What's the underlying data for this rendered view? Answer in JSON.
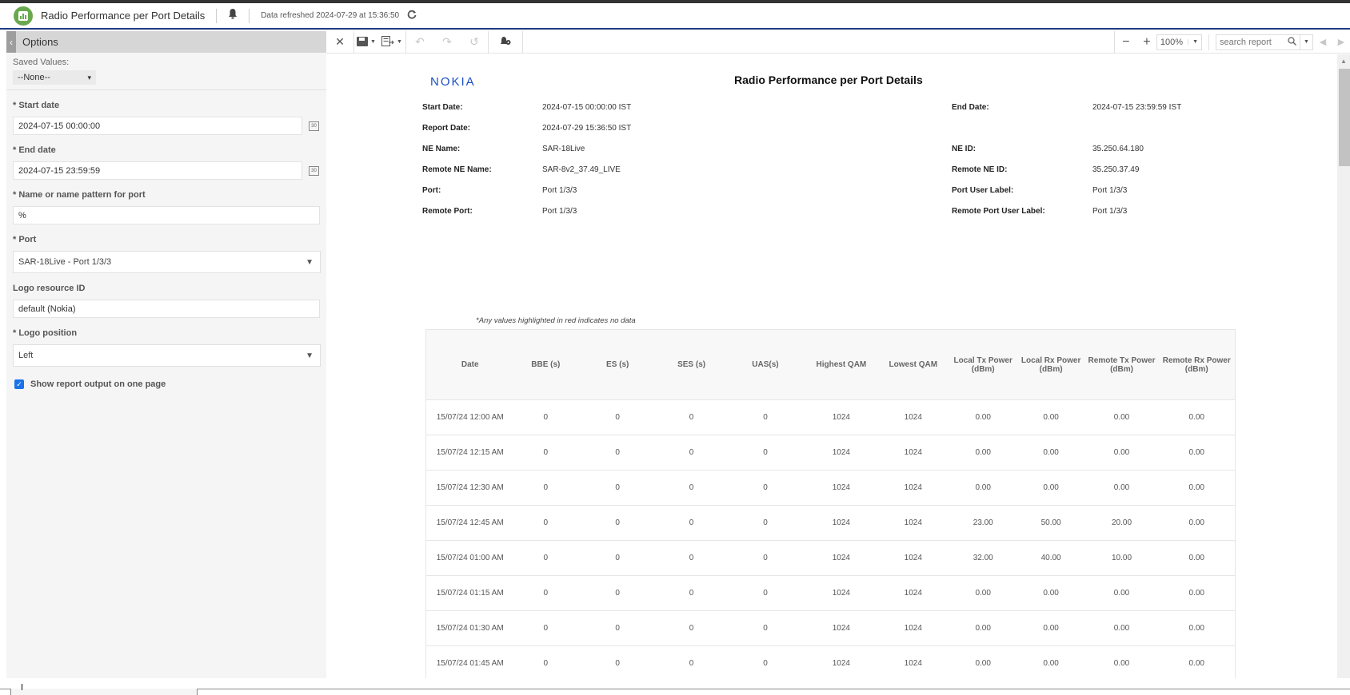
{
  "app": {
    "title": "Radio Performance per Port Details",
    "refresh_text": "Data refreshed 2024-07-29 at 15:36:50",
    "icons": {
      "app": "bar-chart-icon",
      "notifications": "bell-icon",
      "refresh": "refresh-icon"
    }
  },
  "sidebar": {
    "header": "Options",
    "saved_values_label": "Saved Values:",
    "saved_values_selected": "--None--",
    "fields": {
      "start_date": {
        "label": "* Start date",
        "value": "2024-07-15 00:00:00"
      },
      "end_date": {
        "label": "* End date",
        "value": "2024-07-15 23:59:59"
      },
      "port_pattern": {
        "label": "* Name or name pattern for port",
        "value": "%"
      },
      "port": {
        "label": "* Port",
        "value": "SAR-18Live - Port 1/3/3"
      },
      "logo_resource": {
        "label": "Logo resource ID",
        "value": "default (Nokia)"
      },
      "logo_position": {
        "label": "* Logo position",
        "value": "Left"
      }
    },
    "show_one_page": {
      "label": "Show report output on one page",
      "checked": true
    }
  },
  "toolbar": {
    "zoom_level": "100%",
    "search_placeholder": "search report"
  },
  "report": {
    "logo_text": "NOKIA",
    "title": "Radio Performance per Port Details",
    "info_left": [
      {
        "key": "Start Date:",
        "value": "2024-07-15 00:00:00 IST"
      },
      {
        "key": "Report Date:",
        "value": "2024-07-29 15:36:50 IST"
      },
      {
        "key": "NE Name:",
        "value": "SAR-18Live"
      },
      {
        "key": "Remote NE Name:",
        "value": "SAR-8v2_37.49_LIVE"
      },
      {
        "key": "Port:",
        "value": "Port 1/3/3"
      },
      {
        "key": "Remote Port:",
        "value": "Port 1/3/3"
      }
    ],
    "info_right": [
      {
        "key": "End Date:",
        "value": "2024-07-15 23:59:59 IST"
      },
      {
        "key": "NE ID:",
        "value": "35.250.64.180"
      },
      {
        "key": "Remote NE ID:",
        "value": "35.250.37.49"
      },
      {
        "key": "Port User Label:",
        "value": "Port 1/3/3"
      },
      {
        "key": "Remote Port User Label:",
        "value": "Port 1/3/3"
      }
    ],
    "note": "*Any values highlighted in red indicates no data",
    "table": {
      "columns": [
        "Date",
        "BBE (s)",
        "ES (s)",
        "SES (s)",
        "UAS(s)",
        "Highest QAM",
        "Lowest QAM",
        "Local Tx Power (dBm)",
        "Local Rx Power (dBm)",
        "Remote Tx Power (dBm)",
        "Remote Rx Power (dBm)"
      ],
      "rows": [
        [
          "15/07/24 12:00 AM",
          "0",
          "0",
          "0",
          "0",
          "1024",
          "1024",
          "0.00",
          "0.00",
          "0.00",
          "0.00"
        ],
        [
          "15/07/24 12:15 AM",
          "0",
          "0",
          "0",
          "0",
          "1024",
          "1024",
          "0.00",
          "0.00",
          "0.00",
          "0.00"
        ],
        [
          "15/07/24 12:30 AM",
          "0",
          "0",
          "0",
          "0",
          "1024",
          "1024",
          "0.00",
          "0.00",
          "0.00",
          "0.00"
        ],
        [
          "15/07/24 12:45 AM",
          "0",
          "0",
          "0",
          "0",
          "1024",
          "1024",
          "23.00",
          "50.00",
          "20.00",
          "0.00"
        ],
        [
          "15/07/24 01:00 AM",
          "0",
          "0",
          "0",
          "0",
          "1024",
          "1024",
          "32.00",
          "40.00",
          "10.00",
          "0.00"
        ],
        [
          "15/07/24 01:15 AM",
          "0",
          "0",
          "0",
          "0",
          "1024",
          "1024",
          "0.00",
          "0.00",
          "0.00",
          "0.00"
        ],
        [
          "15/07/24 01:30 AM",
          "0",
          "0",
          "0",
          "0",
          "1024",
          "1024",
          "0.00",
          "0.00",
          "0.00",
          "0.00"
        ],
        [
          "15/07/24 01:45 AM",
          "0",
          "0",
          "0",
          "0",
          "1024",
          "1024",
          "0.00",
          "0.00",
          "0.00",
          "0.00"
        ]
      ]
    }
  }
}
